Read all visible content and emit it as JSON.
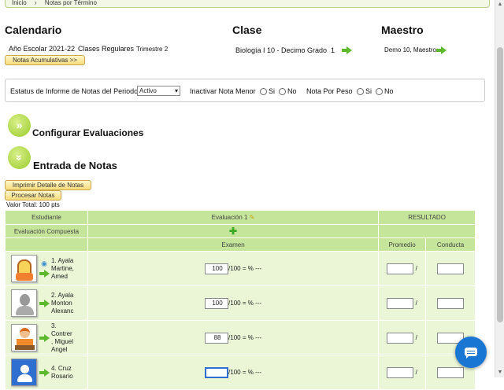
{
  "breadcrumb": [
    "Inicio",
    "Notas por Término"
  ],
  "headers": {
    "calendar": "Calendario",
    "class": "Clase",
    "teacher": "Maestro"
  },
  "calendar": {
    "year": "Año Escolar 2021-22",
    "type": "Clases Regulares",
    "term": "Trimestre 2",
    "accumulated_btn": "Notas Acumulativas >>"
  },
  "class": {
    "name": "Biología I 10 - Decimo Grado",
    "section": "1"
  },
  "teacher": {
    "name": "Demo 10, Maestro"
  },
  "filters": {
    "status_label": "Estatus de Informe de Notas del Periodo",
    "status_value": "Activo",
    "inactivate_label": "Inactivar Nota Menor",
    "weight_label": "Nota Por Peso",
    "yes": "Si",
    "no": "No"
  },
  "sections": {
    "configure": "Configurar Evaluaciones",
    "entry": "Entrada de Notas"
  },
  "buttons": {
    "print": "Imprimir Detalle de Notas",
    "process": "Procesar Notas"
  },
  "total": "Valor Total: 100 pts",
  "table": {
    "student_col": "Estudiante",
    "eval_col": "Evaluación 1",
    "result_col": "RESULTADO",
    "composite": "Evaluación Compuesta",
    "exam": "Examen",
    "average": "Promedio",
    "conduct": "Conducta",
    "score_suffix": "/100 = % ---",
    "rows": [
      {
        "number": "1.",
        "name1": "Ayala",
        "name2": "Martine,",
        "name3": "Amed",
        "score": "100"
      },
      {
        "number": "2.",
        "name1": "Ayala",
        "name2": "Monton",
        "name3": "Alexanc",
        "score": "100"
      },
      {
        "number": "3.",
        "name1": "Contrer",
        "name2": ", Miguel",
        "name3": "Angel",
        "score": "88"
      },
      {
        "number": "4.",
        "name1": "Cruz",
        "name2": "Rosario",
        "name3": "",
        "score": ""
      }
    ],
    "average_sep": "/"
  },
  "colors": {
    "accent_green": "#5cb82d",
    "header_green": "#c5e59a",
    "row_bg": "#eaf6d6",
    "chat_blue": "#1976d2"
  }
}
